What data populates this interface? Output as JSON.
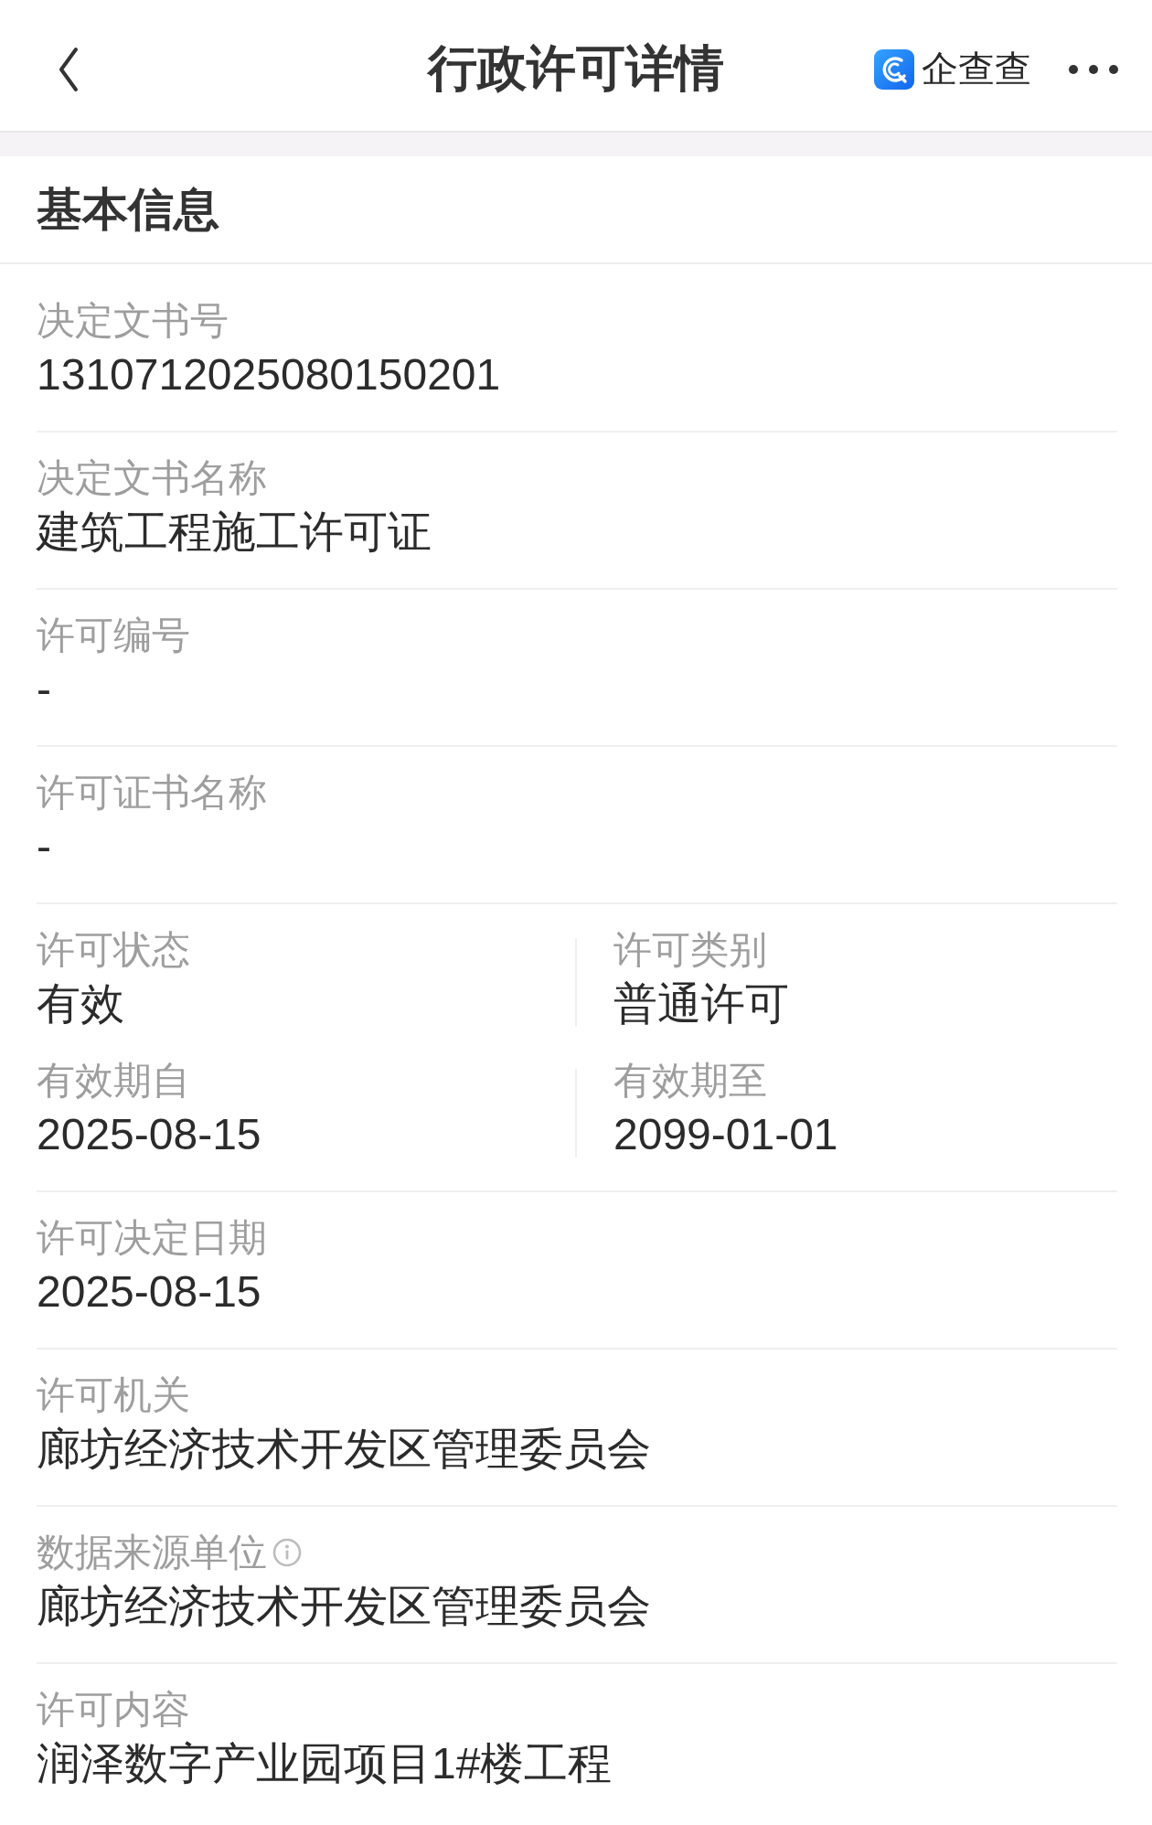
{
  "header": {
    "title": "行政许可详情",
    "brand": "企查查"
  },
  "section": {
    "title": "基本信息",
    "fields": [
      {
        "kind": "full",
        "label": "决定文书号",
        "value": "1310712025080150201",
        "info": false
      },
      {
        "kind": "full",
        "label": "决定文书名称",
        "value": "建筑工程施工许可证",
        "info": false
      },
      {
        "kind": "full",
        "label": "许可编号",
        "value": "-",
        "info": false
      },
      {
        "kind": "full",
        "label": "许可证书名称",
        "value": "-",
        "info": false
      },
      {
        "kind": "grid",
        "cells": [
          {
            "label": "许可状态",
            "value": "有效"
          },
          {
            "label": "许可类别",
            "value": "普通许可"
          },
          {
            "label": "有效期自",
            "value": "2025-08-15"
          },
          {
            "label": "有效期至",
            "value": "2099-01-01"
          }
        ]
      },
      {
        "kind": "full",
        "label": "许可决定日期",
        "value": "2025-08-15",
        "info": false
      },
      {
        "kind": "full",
        "label": "许可机关",
        "value": "廊坊经济技术开发区管理委员会",
        "info": false
      },
      {
        "kind": "full",
        "label": "数据来源单位",
        "value": "廊坊经济技术开发区管理委员会",
        "info": true
      },
      {
        "kind": "full",
        "label": "许可内容",
        "value": "润泽数字产业园项目1#楼工程",
        "info": false
      }
    ]
  }
}
